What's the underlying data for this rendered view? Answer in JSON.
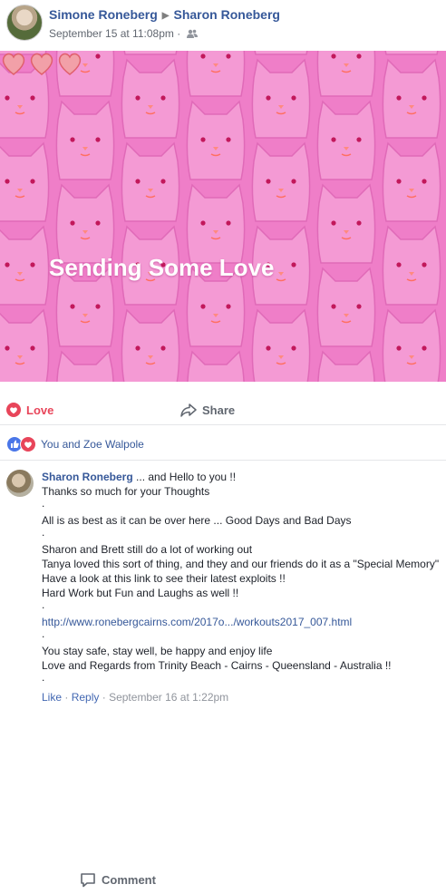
{
  "post": {
    "author": "Simone Roneberg",
    "target": "Sharon Roneberg",
    "timestamp": "September 15 at 11:08pm",
    "privacy_icon": "friends-icon"
  },
  "image": {
    "text": "Sending Some Love",
    "hearts": 3,
    "background_color": "#ef7ec8"
  },
  "actions": {
    "love": "Love",
    "comment": "Comment",
    "share": "Share"
  },
  "reactions": {
    "text": "You and Zoe Walpole"
  },
  "comment": {
    "author": "Sharon Roneberg",
    "opening": "... and Hello to you !!",
    "lines": [
      "Thanks so much for your Thoughts",
      ".",
      "All is as best as it can be over here ... Good Days and Bad Days",
      ".",
      "Sharon and Brett still do a lot of working out",
      "Tanya loved this sort of thing, and they and our friends do it as a \"Special Memory\"",
      "Have a look at this link to see their latest exploits !!",
      "Hard Work but Fun and Laughs as well !!",
      "."
    ],
    "link": "http://www.ronebergcairns.com/2017o.../workouts2017_007.html",
    "closing": [
      ".",
      "You stay safe, stay well, be happy and enjoy life",
      "Love and Regards from Trinity Beach - Cairns - Queensland - Australia !!",
      "."
    ],
    "like": "Like",
    "reply": "Reply",
    "time": "September 16 at 1:22pm"
  }
}
